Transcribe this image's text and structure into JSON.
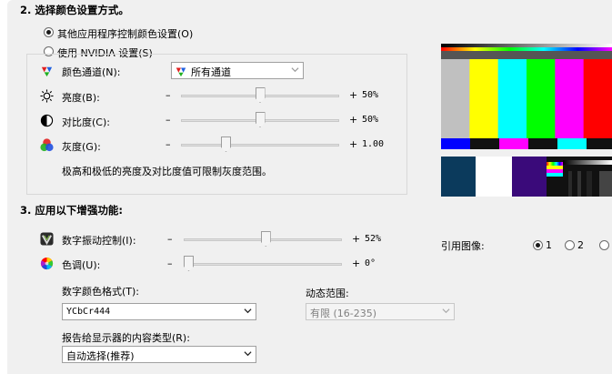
{
  "section2": {
    "title": "2.  选择颜色设置方式。",
    "option_other": "其他应用程序控制颜色设置(O)",
    "option_nvidia": "使用 NVIDIA 设置(S)",
    "channel_label": "颜色通道(N):",
    "channel_value": "所有通道",
    "brightness_label": "亮度(B):",
    "brightness_value": "50%",
    "contrast_label": "对比度(C):",
    "contrast_value": "50%",
    "gamma_label": "灰度(G):",
    "gamma_value": "1.00",
    "note": "极高和极低的亮度及对比度值可限制灰度范围。",
    "minus": "–",
    "plus": "+"
  },
  "section3": {
    "title": "3.  应用以下增强功能:",
    "vibrance_label": "数字振动控制(I):",
    "vibrance_value": "52%",
    "hue_label": "色调(U):",
    "hue_value": "0°",
    "format_label": "数字颜色格式(T):",
    "format_value": "YCbCr444",
    "range_label": "动态范围:",
    "range_value": "有限 (16-235)",
    "content_label": "报告给显示器的内容类型(R):",
    "content_value": "自动选择(推荐)"
  },
  "reference": {
    "label": "引用图像:",
    "options": [
      "1",
      "2"
    ],
    "selected": "1"
  },
  "sliders": {
    "brightness": 0.5,
    "contrast": 0.5,
    "gamma": 0.27,
    "vibrance": 0.52,
    "hue": 0.0
  },
  "colors": {
    "panel_bg": "#f0f0f0",
    "bar_colors": [
      "#c0c0c0",
      "#ffff00",
      "#00ffff",
      "#00ff00",
      "#ff00ff",
      "#ff0000",
      "#0000ff"
    ]
  },
  "icons": {
    "channel": "rgb-diamond-icon",
    "brightness": "sun-icon",
    "contrast": "half-circle-icon",
    "gamma": "rgb-circles-icon",
    "vibrance": "vibrance-icon",
    "hue": "color-wheel-icon"
  }
}
